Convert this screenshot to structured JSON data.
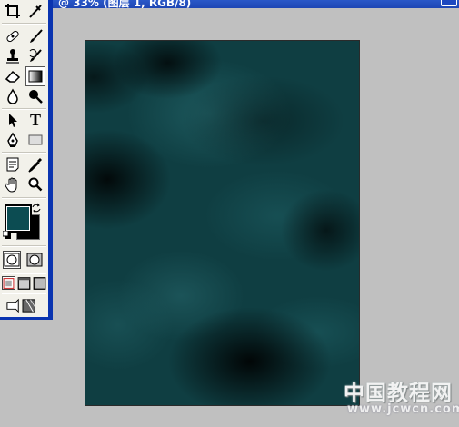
{
  "window": {
    "title": "@ 33% (图层 1, RGB/8)"
  },
  "toolbox": {
    "tools": [
      {
        "name": "crop-tool",
        "icon": "crop-icon"
      },
      {
        "name": "slice-tool",
        "icon": "slice-icon"
      },
      {
        "name": "healing-brush-tool",
        "icon": "bandage-icon"
      },
      {
        "name": "brush-tool",
        "icon": "brush-icon"
      },
      {
        "name": "clone-stamp-tool",
        "icon": "stamp-icon"
      },
      {
        "name": "history-brush-tool",
        "icon": "history-brush-icon"
      },
      {
        "name": "eraser-tool",
        "icon": "eraser-icon"
      },
      {
        "name": "gradient-tool",
        "icon": "gradient-icon"
      },
      {
        "name": "blur-tool",
        "icon": "drop-icon"
      },
      {
        "name": "dodge-tool",
        "icon": "dodge-icon"
      },
      {
        "name": "path-selection-tool",
        "icon": "arrow-icon"
      },
      {
        "name": "type-tool",
        "icon": "type-icon",
        "label": "T"
      },
      {
        "name": "pen-tool",
        "icon": "pen-icon"
      },
      {
        "name": "shape-tool",
        "icon": "rectangle-icon"
      },
      {
        "name": "notes-tool",
        "icon": "note-icon"
      },
      {
        "name": "eyedropper-tool",
        "icon": "eyedropper-icon"
      },
      {
        "name": "hand-tool",
        "icon": "hand-icon"
      },
      {
        "name": "zoom-tool",
        "icon": "magnifier-icon"
      }
    ],
    "foreground_color": "#0c4c52",
    "background_color": "#000000"
  },
  "watermark": {
    "cn": "中国教程网",
    "url": "www.jcwcn.com"
  }
}
